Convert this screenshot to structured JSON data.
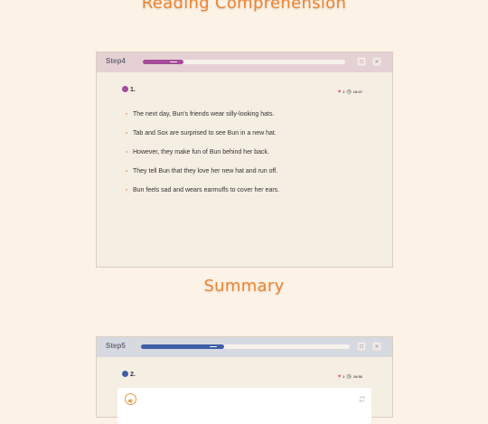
{
  "sections": {
    "reading_title": "Reading Comprehension",
    "summary_title": "Summary"
  },
  "step4": {
    "label": "Step4",
    "progress": 0.2,
    "question_number": "1.",
    "hearts": "2",
    "timer": "19:07",
    "sentences": [
      "The next day, Bun's friends wear silly-looking hats.",
      "Tab and Sox are surprised to see Bun in a new hat.",
      "However, they make fun of Bun behind her back.",
      "They tell Bun that they love her new hat and run off.",
      "Bun feels sad and wears earmuffs to cover her ears."
    ]
  },
  "step5": {
    "label": "Step5",
    "progress": 0.4,
    "question_number": "2.",
    "hearts": "2",
    "timer": "19:56"
  },
  "colors": {
    "accent_orange": "#ee8530",
    "step4_accent": "#a64a9a",
    "step5_accent": "#3f5ea9"
  },
  "icons": [
    "grid-icon",
    "close-icon",
    "heart-icon",
    "clock-icon",
    "speaker-icon",
    "refresh-icon"
  ]
}
